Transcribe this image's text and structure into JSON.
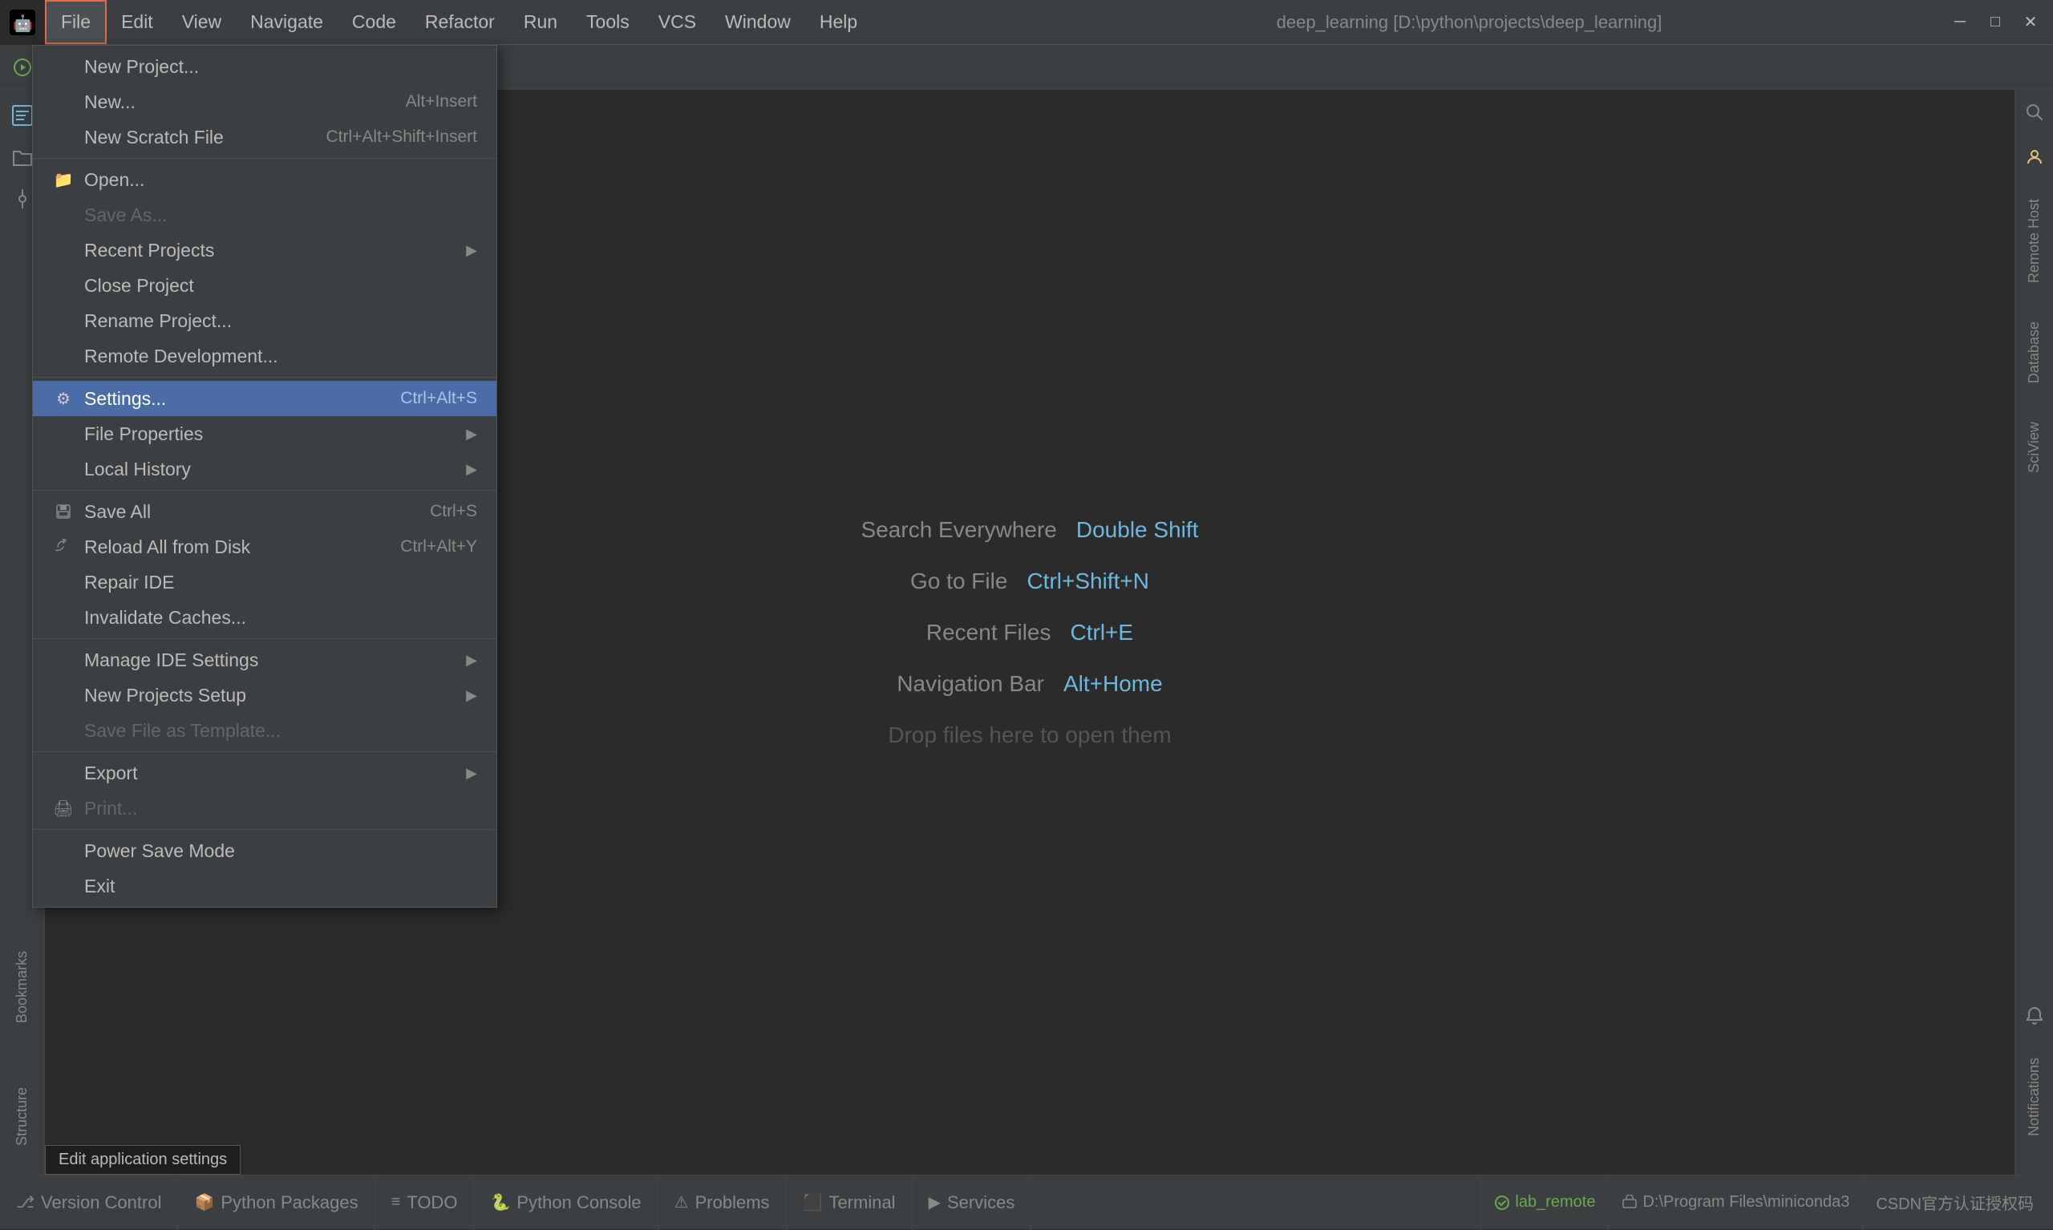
{
  "app": {
    "icon": "🤖",
    "title": "deep_learning [D:\\python\\projects\\deep_learning]"
  },
  "menubar": {
    "items": [
      {
        "label": "File",
        "active": true
      },
      {
        "label": "Edit"
      },
      {
        "label": "View"
      },
      {
        "label": "Navigate"
      },
      {
        "label": "Code"
      },
      {
        "label": "Refactor"
      },
      {
        "label": "Run"
      },
      {
        "label": "Tools"
      },
      {
        "label": "VCS"
      },
      {
        "label": "Window"
      },
      {
        "label": "Help"
      }
    ]
  },
  "titlebar_controls": {
    "minimize": "─",
    "maximize": "□",
    "close": "✕"
  },
  "toolbar": {
    "buttons": [
      "▶",
      "⟳",
      "▶▶",
      "⏹"
    ]
  },
  "file_menu": {
    "sections": [
      {
        "items": [
          {
            "label": "New Project...",
            "icon": "",
            "shortcut": "",
            "arrow": false,
            "disabled": false
          },
          {
            "label": "New...",
            "icon": "",
            "shortcut": "Alt+Insert",
            "arrow": false,
            "disabled": false
          },
          {
            "label": "New Scratch File",
            "icon": "",
            "shortcut": "Ctrl+Alt+Shift+Insert",
            "arrow": false,
            "disabled": false
          }
        ]
      },
      {
        "items": [
          {
            "label": "Open...",
            "icon": "📁",
            "shortcut": "",
            "arrow": false,
            "disabled": false
          },
          {
            "label": "Save As...",
            "icon": "",
            "shortcut": "",
            "arrow": false,
            "disabled": true
          },
          {
            "label": "Recent Projects",
            "icon": "",
            "shortcut": "",
            "arrow": true,
            "disabled": false
          },
          {
            "label": "Close Project",
            "icon": "",
            "shortcut": "",
            "arrow": false,
            "disabled": false
          },
          {
            "label": "Rename Project...",
            "icon": "",
            "shortcut": "",
            "arrow": false,
            "disabled": false
          },
          {
            "label": "Remote Development...",
            "icon": "",
            "shortcut": "",
            "arrow": false,
            "disabled": false
          }
        ]
      },
      {
        "items": [
          {
            "label": "Settings...",
            "icon": "⚙",
            "shortcut": "Ctrl+Alt+S",
            "arrow": false,
            "disabled": false,
            "highlighted": true
          },
          {
            "label": "File Properties",
            "icon": "",
            "shortcut": "",
            "arrow": true,
            "disabled": false
          },
          {
            "label": "Local History",
            "icon": "",
            "shortcut": "",
            "arrow": true,
            "disabled": false
          }
        ]
      },
      {
        "items": [
          {
            "label": "Save All",
            "icon": "💾",
            "shortcut": "Ctrl+S",
            "arrow": false,
            "disabled": false
          },
          {
            "label": "Reload All from Disk",
            "icon": "⟳",
            "shortcut": "Ctrl+Alt+Y",
            "arrow": false,
            "disabled": false
          },
          {
            "label": "Repair IDE",
            "icon": "",
            "shortcut": "",
            "arrow": false,
            "disabled": false
          },
          {
            "label": "Invalidate Caches...",
            "icon": "",
            "shortcut": "",
            "arrow": false,
            "disabled": false
          }
        ]
      },
      {
        "items": [
          {
            "label": "Manage IDE Settings",
            "icon": "",
            "shortcut": "",
            "arrow": true,
            "disabled": false
          },
          {
            "label": "New Projects Setup",
            "icon": "",
            "shortcut": "",
            "arrow": true,
            "disabled": false
          },
          {
            "label": "Save File as Template...",
            "icon": "",
            "shortcut": "",
            "arrow": false,
            "disabled": true
          }
        ]
      },
      {
        "items": [
          {
            "label": "Export",
            "icon": "",
            "shortcut": "",
            "arrow": true,
            "disabled": false
          },
          {
            "label": "Print...",
            "icon": "🖨",
            "shortcut": "",
            "arrow": false,
            "disabled": true
          }
        ]
      },
      {
        "items": [
          {
            "label": "Power Save Mode",
            "icon": "",
            "shortcut": "",
            "arrow": false,
            "disabled": false
          },
          {
            "label": "Exit",
            "icon": "",
            "shortcut": "",
            "arrow": false,
            "disabled": false
          }
        ]
      }
    ]
  },
  "main_content": {
    "welcome_items": [
      {
        "text": "Search Everywhere",
        "shortcut": "Double Shift"
      },
      {
        "text": "Go to File",
        "shortcut": "Ctrl+Shift+N"
      },
      {
        "text": "Recent Files",
        "shortcut": "Ctrl+E"
      },
      {
        "text": "Navigation Bar",
        "shortcut": "Alt+Home"
      },
      {
        "text": "Drop files here to open them",
        "shortcut": ""
      }
    ]
  },
  "right_sidebar": {
    "items": [
      "Remote Host",
      "Database",
      "SciView",
      "Notifications"
    ]
  },
  "left_sidebar": {
    "items": [
      "Project",
      "Bookmarks",
      "Structure"
    ]
  },
  "statusbar": {
    "tabs": [
      {
        "icon": "⎇",
        "label": "Version Control"
      },
      {
        "icon": "📦",
        "label": "Python Packages"
      },
      {
        "icon": "≡",
        "label": "TODO"
      },
      {
        "icon": "🐍",
        "label": "Python Console"
      },
      {
        "icon": "⚠",
        "label": "Problems"
      },
      {
        "icon": "⬛",
        "label": "Terminal"
      },
      {
        "icon": "▶",
        "label": "Services"
      }
    ],
    "right": {
      "lab_remote": "lab_remote",
      "conda_path": "D:\\Program Files\\miniconda3",
      "csdn_text": "CSDN官方认证授权码"
    }
  }
}
